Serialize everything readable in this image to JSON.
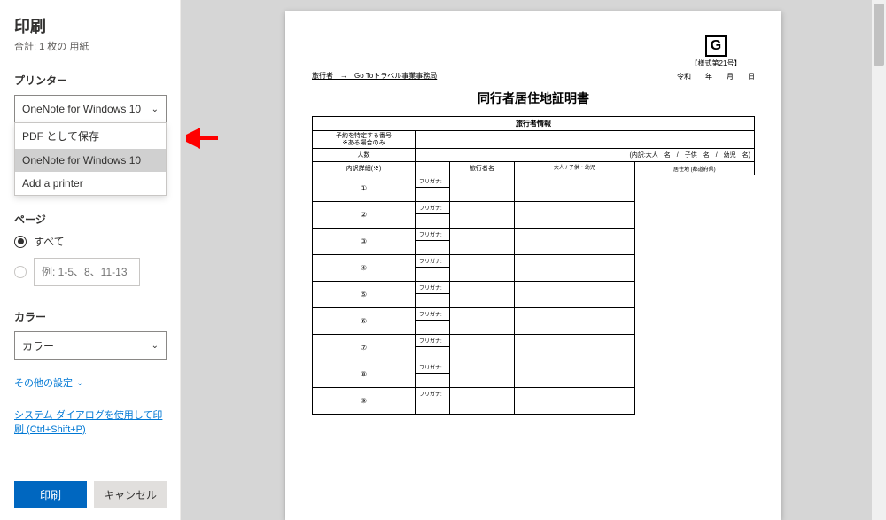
{
  "sidebar": {
    "title": "印刷",
    "subtitle": "合計: 1 枚の 用紙",
    "printer": {
      "label": "プリンター",
      "selected": "OneNote for Windows 10",
      "options": [
        "PDF として保存",
        "OneNote for Windows 10",
        "Add a printer"
      ]
    },
    "pages": {
      "label": "ページ",
      "all": "すべて",
      "range_placeholder": "例: 1-5、8、11-13"
    },
    "color": {
      "label": "カラー",
      "selected": "カラー"
    },
    "more_settings": "その他の設定",
    "system_dialog": "システム ダイアログを使用して印刷 (Ctrl+Shift+P)",
    "buttons": {
      "print": "印刷",
      "cancel": "キャンセル"
    }
  },
  "document": {
    "form_number": "【様式第21号】",
    "era_date": "令和　　年　　月　　日",
    "to_line": "旅行者　→　Go Toトラベル事業事務局",
    "title": "同行者居住地証明書",
    "section_header": "旅行者情報",
    "booking_label": "予約を特定する番号\n※ある場合のみ",
    "count_label": "人数",
    "count_detail": "(内訳:大人　名　/　子供　名　/　幼児　名)",
    "detail_label": "内訳詳細(※)",
    "traveler_name_header": "旅行者名",
    "adult_child_header": "大人 / 子供・幼児",
    "residence_header": "居住地 (都道府県)",
    "furigana": "フリガナ:",
    "row_count": 9
  }
}
